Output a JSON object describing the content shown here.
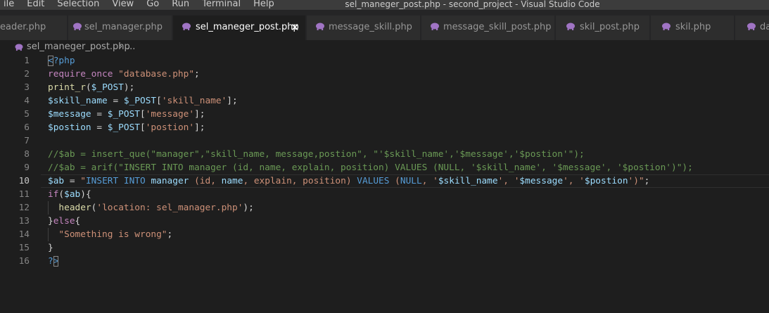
{
  "menu": [
    "ile",
    "Edit",
    "Selection",
    "View",
    "Go",
    "Run",
    "Terminal",
    "Help"
  ],
  "window_title": "sel_maneger_post.php - second_project - Visual Studio Code",
  "tabs": [
    {
      "label": "eader.php",
      "icon": "php-elephant-icon",
      "active": false
    },
    {
      "label": "sel_manager.php",
      "icon": "php-elephant-icon",
      "active": false
    },
    {
      "label": "sel_maneger_post.php",
      "icon": "php-elephant-icon",
      "active": true
    },
    {
      "label": "message_skill.php",
      "icon": "php-elephant-icon",
      "active": false
    },
    {
      "label": "message_skill_post.php",
      "icon": "php-elephant-icon",
      "active": false
    },
    {
      "label": "skil_post.php",
      "icon": "php-elephant-icon",
      "active": false
    },
    {
      "label": "skil.php",
      "icon": "php-elephant-icon",
      "active": false
    },
    {
      "label": "da",
      "icon": "php-elephant-icon",
      "active": false
    }
  ],
  "tab_close_glyph": "✕",
  "breadcrumbs": {
    "file": "sel_maneger_post.php",
    "separator": "›",
    "more": "..."
  },
  "colors": {
    "editor_bg": "#1e1e1e",
    "tab_inactive_bg": "#2d2d2d",
    "php_icon": "#a074c4",
    "keyword": "#c586c0",
    "variable": "#9cdcfe",
    "string": "#ce9178",
    "comment": "#6a9955",
    "function": "#dcdcaa"
  },
  "current_line": 10,
  "lines": [
    {
      "n": "1",
      "tokens": [
        {
          "t": "<",
          "c": "tag",
          "box": true
        },
        {
          "t": "?php",
          "c": "tag"
        }
      ]
    },
    {
      "n": "2",
      "tokens": [
        {
          "t": "require_once",
          "c": "kw"
        },
        {
          "t": " ",
          "c": "plain"
        },
        {
          "t": "\"database.php\"",
          "c": "str"
        },
        {
          "t": ";",
          "c": "plain"
        }
      ]
    },
    {
      "n": "3",
      "tokens": [
        {
          "t": "print_r",
          "c": "fn"
        },
        {
          "t": "(",
          "c": "plain"
        },
        {
          "t": "$_POST",
          "c": "var"
        },
        {
          "t": ");",
          "c": "plain"
        }
      ]
    },
    {
      "n": "4",
      "tokens": [
        {
          "t": "$skill_name",
          "c": "var"
        },
        {
          "t": " = ",
          "c": "plain"
        },
        {
          "t": "$_POST",
          "c": "var"
        },
        {
          "t": "[",
          "c": "plain"
        },
        {
          "t": "'skill_name'",
          "c": "str"
        },
        {
          "t": "];",
          "c": "plain"
        }
      ]
    },
    {
      "n": "5",
      "tokens": [
        {
          "t": "$message",
          "c": "var"
        },
        {
          "t": " = ",
          "c": "plain"
        },
        {
          "t": "$_POST",
          "c": "var"
        },
        {
          "t": "[",
          "c": "plain"
        },
        {
          "t": "'message'",
          "c": "str"
        },
        {
          "t": "];",
          "c": "plain"
        }
      ]
    },
    {
      "n": "6",
      "tokens": [
        {
          "t": "$postion",
          "c": "var"
        },
        {
          "t": " = ",
          "c": "plain"
        },
        {
          "t": "$_POST",
          "c": "var"
        },
        {
          "t": "[",
          "c": "plain"
        },
        {
          "t": "'postion'",
          "c": "str"
        },
        {
          "t": "];",
          "c": "plain"
        }
      ]
    },
    {
      "n": "7",
      "tokens": []
    },
    {
      "n": "8",
      "tokens": [
        {
          "t": "//$ab = insert_que(\"manager\",\"skill_name, message,postion\", \"'$skill_name','$message','$postion'\");",
          "c": "com"
        }
      ]
    },
    {
      "n": "9",
      "tokens": [
        {
          "t": "//$ab = arif(\"INSERT INTO manager (id, name, explain, position) VALUES (NULL, '$skill_name', '$message', '$postion')\");",
          "c": "com"
        }
      ]
    },
    {
      "n": "10",
      "tokens": [
        {
          "t": "$ab",
          "c": "var"
        },
        {
          "t": " = ",
          "c": "plain"
        },
        {
          "t": "\"",
          "c": "str"
        },
        {
          "t": "INSERT INTO",
          "c": "tag"
        },
        {
          "t": " ",
          "c": "str"
        },
        {
          "t": "manager",
          "c": "var"
        },
        {
          "t": " (id, ",
          "c": "str"
        },
        {
          "t": "name",
          "c": "var"
        },
        {
          "t": ", explain, position) ",
          "c": "str"
        },
        {
          "t": "VALUES",
          "c": "tag"
        },
        {
          "t": " (",
          "c": "str"
        },
        {
          "t": "NULL",
          "c": "tag"
        },
        {
          "t": ", '",
          "c": "str"
        },
        {
          "t": "$skill_name",
          "c": "var"
        },
        {
          "t": "', '",
          "c": "str"
        },
        {
          "t": "$message",
          "c": "var"
        },
        {
          "t": "', '",
          "c": "str"
        },
        {
          "t": "$postion",
          "c": "var"
        },
        {
          "t": "')\"",
          "c": "str"
        },
        {
          "t": ";",
          "c": "plain"
        }
      ]
    },
    {
      "n": "11",
      "tokens": [
        {
          "t": "if",
          "c": "kw"
        },
        {
          "t": "(",
          "c": "plain"
        },
        {
          "t": "$ab",
          "c": "var"
        },
        {
          "t": "){",
          "c": "plain"
        }
      ]
    },
    {
      "n": "12",
      "guide": true,
      "tokens": [
        {
          "t": "  ",
          "c": "plain"
        },
        {
          "t": "header",
          "c": "fn"
        },
        {
          "t": "(",
          "c": "plain"
        },
        {
          "t": "'location: sel_manager.php'",
          "c": "str"
        },
        {
          "t": ");",
          "c": "plain"
        }
      ]
    },
    {
      "n": "13",
      "tokens": [
        {
          "t": "}",
          "c": "plain"
        },
        {
          "t": "else",
          "c": "kw"
        },
        {
          "t": "{",
          "c": "plain"
        }
      ]
    },
    {
      "n": "14",
      "guide": true,
      "tokens": [
        {
          "t": "  ",
          "c": "plain"
        },
        {
          "t": "\"Something is wrong\"",
          "c": "str"
        },
        {
          "t": ";",
          "c": "plain"
        }
      ]
    },
    {
      "n": "15",
      "tokens": [
        {
          "t": "}",
          "c": "plain"
        }
      ]
    },
    {
      "n": "16",
      "tokens": [
        {
          "t": "?",
          "c": "tag"
        },
        {
          "t": ">",
          "c": "tag",
          "box": true
        }
      ]
    }
  ]
}
